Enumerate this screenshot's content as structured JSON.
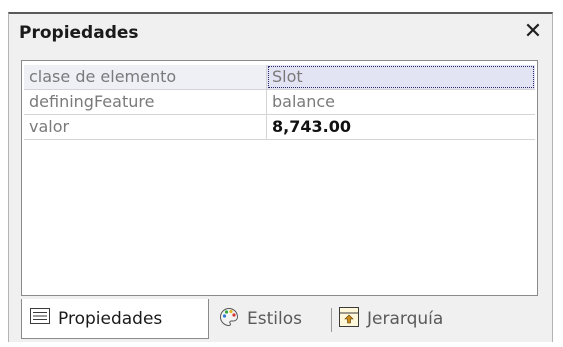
{
  "panel": {
    "title": "Propiedades",
    "close_label": "✕"
  },
  "properties": [
    {
      "name": "clase de elemento",
      "value": "Slot"
    },
    {
      "name": "definingFeature",
      "value": "balance"
    },
    {
      "name": "valor",
      "value": "8,743.00"
    }
  ],
  "tabs": [
    {
      "label": "Propiedades",
      "icon": "properties-list-icon",
      "active": true
    },
    {
      "label": "Estilos",
      "icon": "palette-icon",
      "active": false
    },
    {
      "label": "Jerarquía",
      "icon": "hierarchy-icon",
      "active": false
    }
  ],
  "colors": {
    "selected_row": "#e2e4f4",
    "panel_bg": "#f0f0f0"
  }
}
